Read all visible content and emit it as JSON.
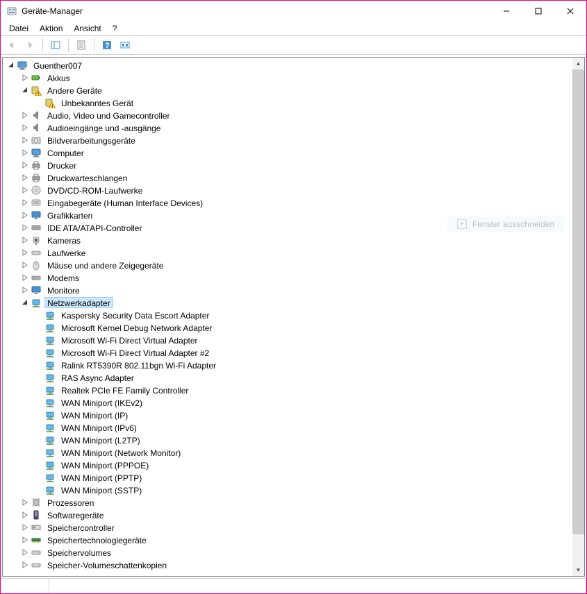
{
  "window": {
    "title": "Geräte-Manager"
  },
  "menu": {
    "file": "Datei",
    "action": "Aktion",
    "view": "Ansicht",
    "help": "?"
  },
  "overlay": {
    "snip": "Fenster ausschneiden"
  },
  "tree": [
    {
      "depth": 0,
      "state": "open",
      "icon": "computer",
      "label": "Guenther007"
    },
    {
      "depth": 1,
      "state": "closed",
      "icon": "battery",
      "label": "Akkus"
    },
    {
      "depth": 1,
      "state": "open",
      "icon": "warning-device",
      "label": "Andere Geräte"
    },
    {
      "depth": 2,
      "state": "leaf",
      "icon": "warning-device",
      "label": "Unbekanntes Gerät"
    },
    {
      "depth": 1,
      "state": "closed",
      "icon": "audio",
      "label": "Audio, Video und Gamecontroller"
    },
    {
      "depth": 1,
      "state": "closed",
      "icon": "audio",
      "label": "Audioeingänge und -ausgänge"
    },
    {
      "depth": 1,
      "state": "closed",
      "icon": "imaging",
      "label": "Bildverarbeitungsgeräte"
    },
    {
      "depth": 1,
      "state": "closed",
      "icon": "computer",
      "label": "Computer"
    },
    {
      "depth": 1,
      "state": "closed",
      "icon": "printer",
      "label": "Drucker"
    },
    {
      "depth": 1,
      "state": "closed",
      "icon": "printer",
      "label": "Druckwarteschlangen"
    },
    {
      "depth": 1,
      "state": "closed",
      "icon": "disc",
      "label": "DVD/CD-ROM-Laufwerke"
    },
    {
      "depth": 1,
      "state": "closed",
      "icon": "hid",
      "label": "Eingabegeräte (Human Interface Devices)"
    },
    {
      "depth": 1,
      "state": "closed",
      "icon": "display",
      "label": "Grafikkarten"
    },
    {
      "depth": 1,
      "state": "closed",
      "icon": "ide",
      "label": "IDE ATA/ATAPI-Controller"
    },
    {
      "depth": 1,
      "state": "closed",
      "icon": "camera",
      "label": "Kameras"
    },
    {
      "depth": 1,
      "state": "closed",
      "icon": "drive",
      "label": "Laufwerke"
    },
    {
      "depth": 1,
      "state": "closed",
      "icon": "mouse",
      "label": "Mäuse und andere Zeigegeräte"
    },
    {
      "depth": 1,
      "state": "closed",
      "icon": "modem",
      "label": "Modems"
    },
    {
      "depth": 1,
      "state": "closed",
      "icon": "display",
      "label": "Monitore"
    },
    {
      "depth": 1,
      "state": "open",
      "icon": "network",
      "label": "Netzwerkadapter",
      "selected": true
    },
    {
      "depth": 2,
      "state": "leaf",
      "icon": "network",
      "label": "Kaspersky Security Data Escort Adapter"
    },
    {
      "depth": 2,
      "state": "leaf",
      "icon": "network",
      "label": "Microsoft Kernel Debug Network Adapter"
    },
    {
      "depth": 2,
      "state": "leaf",
      "icon": "network",
      "label": "Microsoft Wi-Fi Direct Virtual Adapter"
    },
    {
      "depth": 2,
      "state": "leaf",
      "icon": "network",
      "label": "Microsoft Wi-Fi Direct Virtual Adapter #2"
    },
    {
      "depth": 2,
      "state": "leaf",
      "icon": "network",
      "label": "Ralink RT5390R 802.11bgn Wi-Fi Adapter"
    },
    {
      "depth": 2,
      "state": "leaf",
      "icon": "network",
      "label": "RAS Async Adapter"
    },
    {
      "depth": 2,
      "state": "leaf",
      "icon": "network",
      "label": "Realtek PCIe FE Family Controller"
    },
    {
      "depth": 2,
      "state": "leaf",
      "icon": "network",
      "label": "WAN Miniport (IKEv2)"
    },
    {
      "depth": 2,
      "state": "leaf",
      "icon": "network",
      "label": "WAN Miniport (IP)"
    },
    {
      "depth": 2,
      "state": "leaf",
      "icon": "network",
      "label": "WAN Miniport (IPv6)"
    },
    {
      "depth": 2,
      "state": "leaf",
      "icon": "network",
      "label": "WAN Miniport (L2TP)"
    },
    {
      "depth": 2,
      "state": "leaf",
      "icon": "network",
      "label": "WAN Miniport (Network Monitor)"
    },
    {
      "depth": 2,
      "state": "leaf",
      "icon": "network",
      "label": "WAN Miniport (PPPOE)"
    },
    {
      "depth": 2,
      "state": "leaf",
      "icon": "network",
      "label": "WAN Miniport (PPTP)"
    },
    {
      "depth": 2,
      "state": "leaf",
      "icon": "network",
      "label": "WAN Miniport (SSTP)"
    },
    {
      "depth": 1,
      "state": "closed",
      "icon": "cpu",
      "label": "Prozessoren"
    },
    {
      "depth": 1,
      "state": "closed",
      "icon": "software",
      "label": "Softwaregeräte"
    },
    {
      "depth": 1,
      "state": "closed",
      "icon": "storage-ctrl",
      "label": "Speichercontroller"
    },
    {
      "depth": 1,
      "state": "closed",
      "icon": "memory",
      "label": "Speichertechnologiegeräte"
    },
    {
      "depth": 1,
      "state": "closed",
      "icon": "drive",
      "label": "Speichervolumes"
    },
    {
      "depth": 1,
      "state": "closed",
      "icon": "drive",
      "label": "Speicher-Volumeschattenkopien"
    }
  ]
}
